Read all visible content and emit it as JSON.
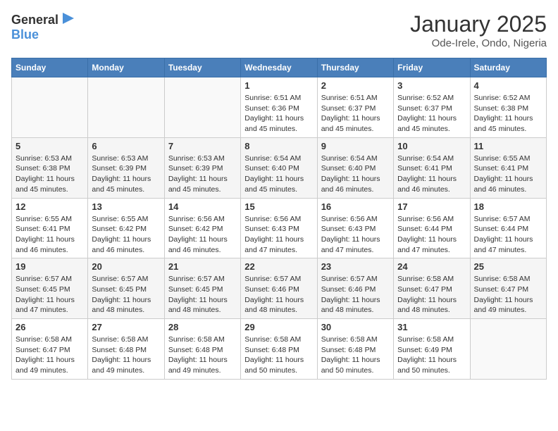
{
  "logo": {
    "general": "General",
    "blue": "Blue"
  },
  "header": {
    "month": "January 2025",
    "location": "Ode-Irele, Ondo, Nigeria"
  },
  "weekdays": [
    "Sunday",
    "Monday",
    "Tuesday",
    "Wednesday",
    "Thursday",
    "Friday",
    "Saturday"
  ],
  "weeks": [
    [
      {
        "day": "",
        "info": ""
      },
      {
        "day": "",
        "info": ""
      },
      {
        "day": "",
        "info": ""
      },
      {
        "day": "1",
        "info": "Sunrise: 6:51 AM\nSunset: 6:36 PM\nDaylight: 11 hours\nand 45 minutes."
      },
      {
        "day": "2",
        "info": "Sunrise: 6:51 AM\nSunset: 6:37 PM\nDaylight: 11 hours\nand 45 minutes."
      },
      {
        "day": "3",
        "info": "Sunrise: 6:52 AM\nSunset: 6:37 PM\nDaylight: 11 hours\nand 45 minutes."
      },
      {
        "day": "4",
        "info": "Sunrise: 6:52 AM\nSunset: 6:38 PM\nDaylight: 11 hours\nand 45 minutes."
      }
    ],
    [
      {
        "day": "5",
        "info": "Sunrise: 6:53 AM\nSunset: 6:38 PM\nDaylight: 11 hours\nand 45 minutes."
      },
      {
        "day": "6",
        "info": "Sunrise: 6:53 AM\nSunset: 6:39 PM\nDaylight: 11 hours\nand 45 minutes."
      },
      {
        "day": "7",
        "info": "Sunrise: 6:53 AM\nSunset: 6:39 PM\nDaylight: 11 hours\nand 45 minutes."
      },
      {
        "day": "8",
        "info": "Sunrise: 6:54 AM\nSunset: 6:40 PM\nDaylight: 11 hours\nand 45 minutes."
      },
      {
        "day": "9",
        "info": "Sunrise: 6:54 AM\nSunset: 6:40 PM\nDaylight: 11 hours\nand 46 minutes."
      },
      {
        "day": "10",
        "info": "Sunrise: 6:54 AM\nSunset: 6:41 PM\nDaylight: 11 hours\nand 46 minutes."
      },
      {
        "day": "11",
        "info": "Sunrise: 6:55 AM\nSunset: 6:41 PM\nDaylight: 11 hours\nand 46 minutes."
      }
    ],
    [
      {
        "day": "12",
        "info": "Sunrise: 6:55 AM\nSunset: 6:41 PM\nDaylight: 11 hours\nand 46 minutes."
      },
      {
        "day": "13",
        "info": "Sunrise: 6:55 AM\nSunset: 6:42 PM\nDaylight: 11 hours\nand 46 minutes."
      },
      {
        "day": "14",
        "info": "Sunrise: 6:56 AM\nSunset: 6:42 PM\nDaylight: 11 hours\nand 46 minutes."
      },
      {
        "day": "15",
        "info": "Sunrise: 6:56 AM\nSunset: 6:43 PM\nDaylight: 11 hours\nand 47 minutes."
      },
      {
        "day": "16",
        "info": "Sunrise: 6:56 AM\nSunset: 6:43 PM\nDaylight: 11 hours\nand 47 minutes."
      },
      {
        "day": "17",
        "info": "Sunrise: 6:56 AM\nSunset: 6:44 PM\nDaylight: 11 hours\nand 47 minutes."
      },
      {
        "day": "18",
        "info": "Sunrise: 6:57 AM\nSunset: 6:44 PM\nDaylight: 11 hours\nand 47 minutes."
      }
    ],
    [
      {
        "day": "19",
        "info": "Sunrise: 6:57 AM\nSunset: 6:45 PM\nDaylight: 11 hours\nand 47 minutes."
      },
      {
        "day": "20",
        "info": "Sunrise: 6:57 AM\nSunset: 6:45 PM\nDaylight: 11 hours\nand 48 minutes."
      },
      {
        "day": "21",
        "info": "Sunrise: 6:57 AM\nSunset: 6:45 PM\nDaylight: 11 hours\nand 48 minutes."
      },
      {
        "day": "22",
        "info": "Sunrise: 6:57 AM\nSunset: 6:46 PM\nDaylight: 11 hours\nand 48 minutes."
      },
      {
        "day": "23",
        "info": "Sunrise: 6:57 AM\nSunset: 6:46 PM\nDaylight: 11 hours\nand 48 minutes."
      },
      {
        "day": "24",
        "info": "Sunrise: 6:58 AM\nSunset: 6:47 PM\nDaylight: 11 hours\nand 48 minutes."
      },
      {
        "day": "25",
        "info": "Sunrise: 6:58 AM\nSunset: 6:47 PM\nDaylight: 11 hours\nand 49 minutes."
      }
    ],
    [
      {
        "day": "26",
        "info": "Sunrise: 6:58 AM\nSunset: 6:47 PM\nDaylight: 11 hours\nand 49 minutes."
      },
      {
        "day": "27",
        "info": "Sunrise: 6:58 AM\nSunset: 6:48 PM\nDaylight: 11 hours\nand 49 minutes."
      },
      {
        "day": "28",
        "info": "Sunrise: 6:58 AM\nSunset: 6:48 PM\nDaylight: 11 hours\nand 49 minutes."
      },
      {
        "day": "29",
        "info": "Sunrise: 6:58 AM\nSunset: 6:48 PM\nDaylight: 11 hours\nand 50 minutes."
      },
      {
        "day": "30",
        "info": "Sunrise: 6:58 AM\nSunset: 6:48 PM\nDaylight: 11 hours\nand 50 minutes."
      },
      {
        "day": "31",
        "info": "Sunrise: 6:58 AM\nSunset: 6:49 PM\nDaylight: 11 hours\nand 50 minutes."
      },
      {
        "day": "",
        "info": ""
      }
    ]
  ]
}
